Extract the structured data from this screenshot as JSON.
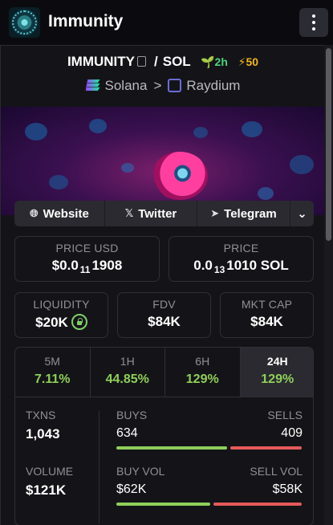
{
  "app": {
    "title": "Immunity"
  },
  "pair": {
    "base": "IMMUNITY",
    "quote": "SOL",
    "separator": "/",
    "age": "2h",
    "boosts": "50",
    "chain": "Solana",
    "dex": "Raydium"
  },
  "socials": {
    "website": "Website",
    "twitter": "Twitter",
    "telegram": "Telegram"
  },
  "stats": {
    "price_usd_label": "PRICE USD",
    "price_usd_prefix": "$0.0",
    "price_usd_zeros": "11",
    "price_usd_digits": "1908",
    "price_label": "PRICE",
    "price_prefix": "0.0",
    "price_zeros": "13",
    "price_digits": "1010 SOL",
    "liquidity_label": "LIQUIDITY",
    "liquidity": "$20K",
    "fdv_label": "FDV",
    "fdv": "$84K",
    "mcap_label": "MKT CAP",
    "mcap": "$84K"
  },
  "timeframes": [
    {
      "label": "5M",
      "change": "7.11%"
    },
    {
      "label": "1H",
      "change": "44.85%"
    },
    {
      "label": "6H",
      "change": "129%"
    },
    {
      "label": "24H",
      "change": "129%"
    }
  ],
  "active_timeframe": "24H",
  "metrics": {
    "txns_label": "TXNS",
    "txns": "1,043",
    "buys_label": "BUYS",
    "buys": "634",
    "sells_label": "SELLS",
    "sells": "409",
    "buy_ratio": 0.608,
    "volume_label": "VOLUME",
    "volume": "$121K",
    "buy_vol_label": "BUY VOL",
    "buy_vol": "$62K",
    "sell_vol_label": "SELL VOL",
    "sell_vol": "$58K",
    "buy_vol_ratio": 0.517
  },
  "colors": {
    "positive": "#8fcf5a",
    "negative": "#e55a5a",
    "age": "#4ed17a",
    "boost": "#f0b429"
  }
}
